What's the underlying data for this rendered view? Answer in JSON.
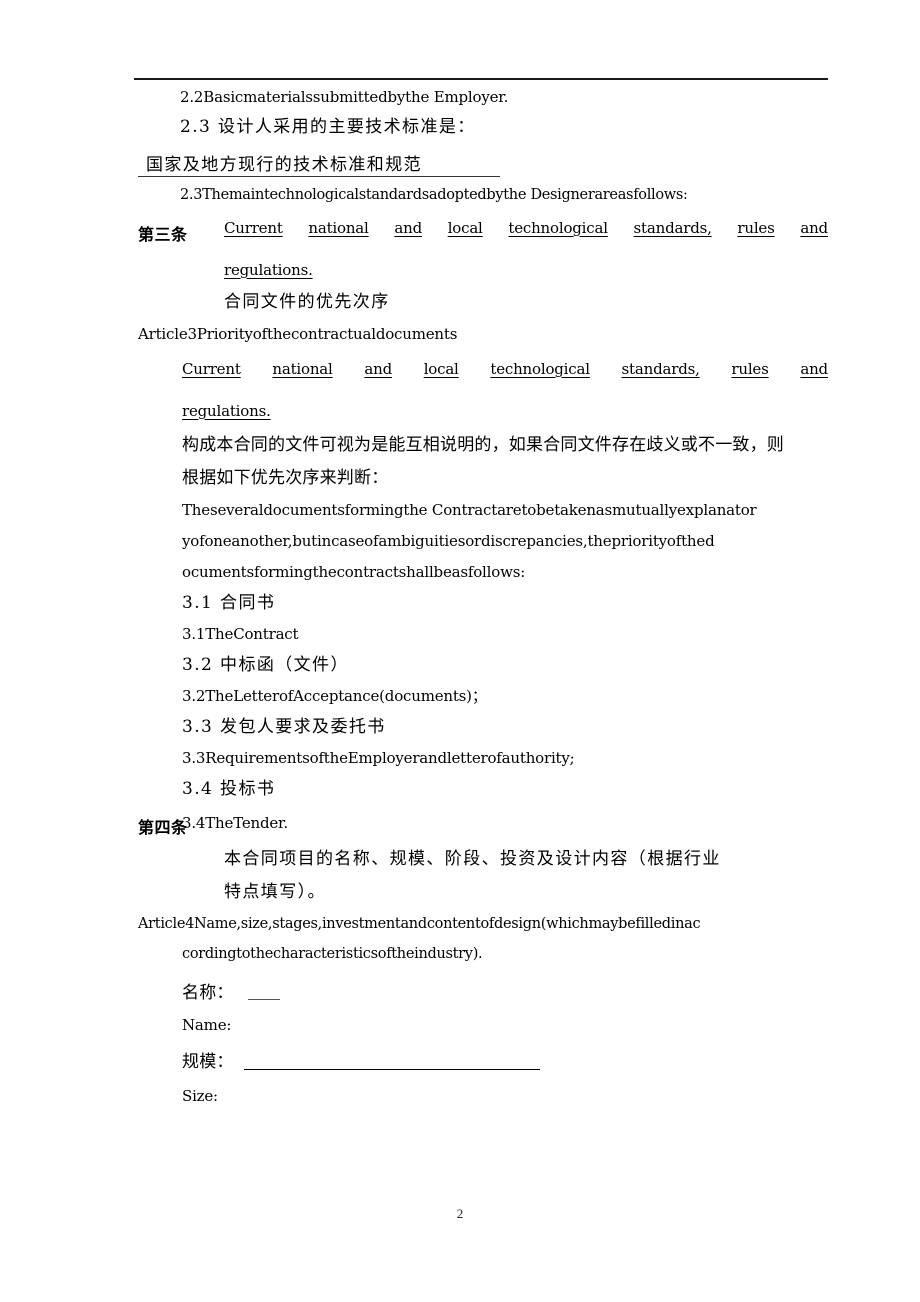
{
  "document": {
    "page_number": "2",
    "header_rule": true
  },
  "lines": {
    "l1_en_22": "2.2Basicmaterialssubmittedbythe Employer.",
    "l2_cn_23": "2.3 设计人采用的主要技术标准是：",
    "l3_cn_fill": "国家及地方现行的技术标准和规范",
    "l4_en_23": "2.3Themaintechnologicalstandardsadoptedbythe Designerareasfollows:",
    "article3_label": "第三条",
    "l5a_part1": "Current",
    "l5a_part2": "national",
    "l5a_part3": "and",
    "l5a_part4": "local",
    "l5a_part5": "technological",
    "l5a_part6": "standards,",
    "l5a_part7": "rules",
    "l5a_part8": "and",
    "l5b": "regulations.",
    "l6_cn_title": "合同文件的优先次序",
    "l7_en_article3": "Article3Priorityofthecontractualdocuments",
    "l8a_part1": "Current",
    "l8a_part2": "national",
    "l8a_part3": "and",
    "l8a_part4": "local",
    "l8a_part5": "technological",
    "l8a_part6": "standards,",
    "l8a_part7": "rules",
    "l8a_part8": "and",
    "l8b": "regulations.",
    "l9_cn_a": "构成本合同的文件可视为是能互相说明的，如果合同文件存在歧义或不一致，则",
    "l9_cn_b": "根据如下优先次序来判断：",
    "l10_en_a": "Theseveraldocumentsformingthe Contractaretobetakenasmutuallyexplanator",
    "l10_en_b": "yofoneanother,butincaseofambiguitiesordiscrepancies,thepriorityofthed",
    "l10_en_c": "ocumentsformingthecontractshallbeasfollows:",
    "l11_cn_31": "3.1 合同书",
    "l12_en_31": "3.1TheContract",
    "l13_cn_32": "3.2 中标函（文件）",
    "l14_en_32": "3.2TheLetterofAcceptance(documents)；",
    "l15_cn_33": "3.3 发包人要求及委托书",
    "l16_en_33": "3.3RequirementsoftheEmployerandletterofauthority;",
    "l17_cn_34": "3.4 投标书",
    "article4_label": "第四条",
    "l18_en_34": "3.4TheTender.",
    "l19_cn_a": "本合同项目的名称、规模、阶段、投资及设计内容（根据行业",
    "l19_cn_b": "特点填写）。",
    "l20_en_a": "Article4Name,size,stages,investmentandcontentofdesign(whichmaybefilledinac",
    "l20_en_b": "cordingtothecharacteristicsoftheindustry).",
    "l21_cn_name": "名称：",
    "l22_en_name": "Name:",
    "l23_cn_size": "规模：",
    "l24_en_size": "Size:"
  }
}
